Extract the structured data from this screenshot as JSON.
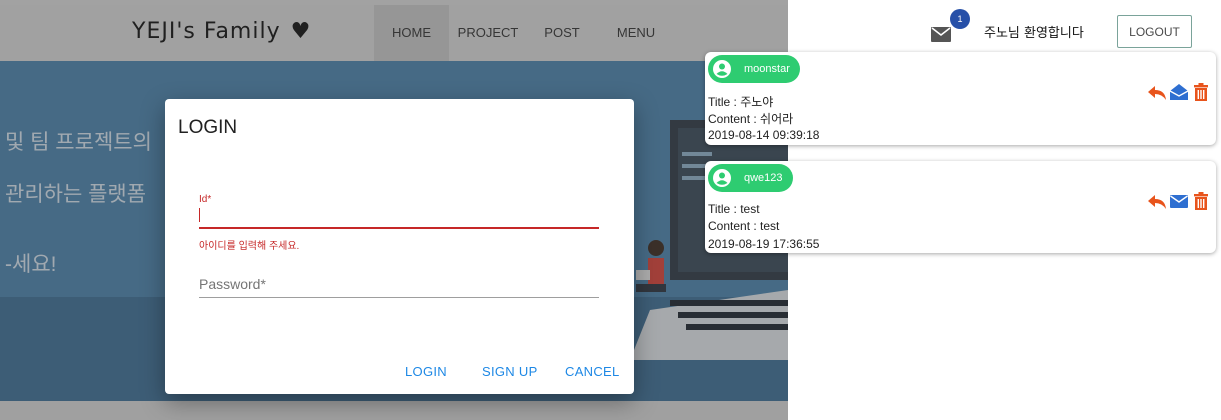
{
  "site": {
    "brand": "YEJI's Family",
    "nav": [
      "HOME",
      "PROJECT",
      "POST",
      "MENU"
    ],
    "hero_lines": [
      "및 팀 프로젝트의",
      "관리하는 플랫폼",
      "-세요!"
    ]
  },
  "login_modal": {
    "title": "LOGIN",
    "id_label": "Id*",
    "id_value": "",
    "id_error": "아이디를 입력해 주세요.",
    "password_label": "Password*",
    "buttons": {
      "login": "LOGIN",
      "signup": "SIGN UP",
      "cancel": "CANCEL"
    }
  },
  "header": {
    "unread_count": "1",
    "welcome": "주노님 환영합니다",
    "logout_label": "LOGOUT"
  },
  "messages": [
    {
      "sender": "moonstar",
      "title": "Title : 주노야",
      "content": "Content : 쉬어라",
      "date": "2019-08-14 09:39:18",
      "read": true
    },
    {
      "sender": "qwe123",
      "title": "Title : test",
      "content": "Content : test",
      "date": "2019-08-19 17:36:55",
      "read": false
    }
  ],
  "icons": {
    "mail": "mail-icon",
    "avatar": "account-circle-icon",
    "reply": "reply-icon",
    "opened": "mail-open-icon",
    "unread": "mail-icon",
    "delete": "trash-icon"
  },
  "colors": {
    "chip": "#2ecc71",
    "action": "#e8541c",
    "mail_action": "#2e6fd1",
    "error": "#c62828",
    "link": "#1e88e5",
    "badge": "#2750a8",
    "hero": "#4c83ad"
  }
}
